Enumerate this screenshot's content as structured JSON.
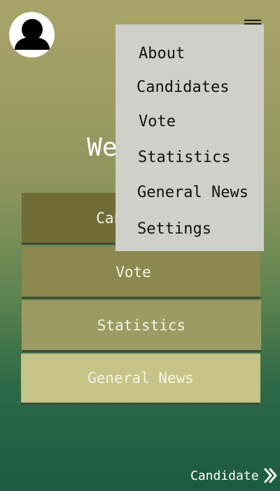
{
  "header": {
    "avatar_icon": "user-avatar-icon",
    "menu_icon": "hamburger-menu-icon"
  },
  "main": {
    "welcome": "Welcome",
    "buttons": [
      {
        "label": "Candidates"
      },
      {
        "label": "Vote"
      },
      {
        "label": "Statistics"
      },
      {
        "label": "General News"
      }
    ]
  },
  "dropdown": {
    "items": [
      {
        "label": "About"
      },
      {
        "label": "Candidates"
      },
      {
        "label": "Vote"
      },
      {
        "label": "Statistics"
      },
      {
        "label": "General News"
      },
      {
        "label": "Settings"
      }
    ]
  },
  "footer": {
    "role_label": "Candidate",
    "role_icon": "double-chevron-right-icon"
  },
  "colors": {
    "background_top": "#a8a46a",
    "background_bottom": "#1b5a43",
    "dropdown_bg": "#cfd0c7",
    "button_candidates": "#6f6c37",
    "button_vote": "#8b894f",
    "button_statistics": "#9b9b63",
    "button_news": "#c5c386"
  }
}
